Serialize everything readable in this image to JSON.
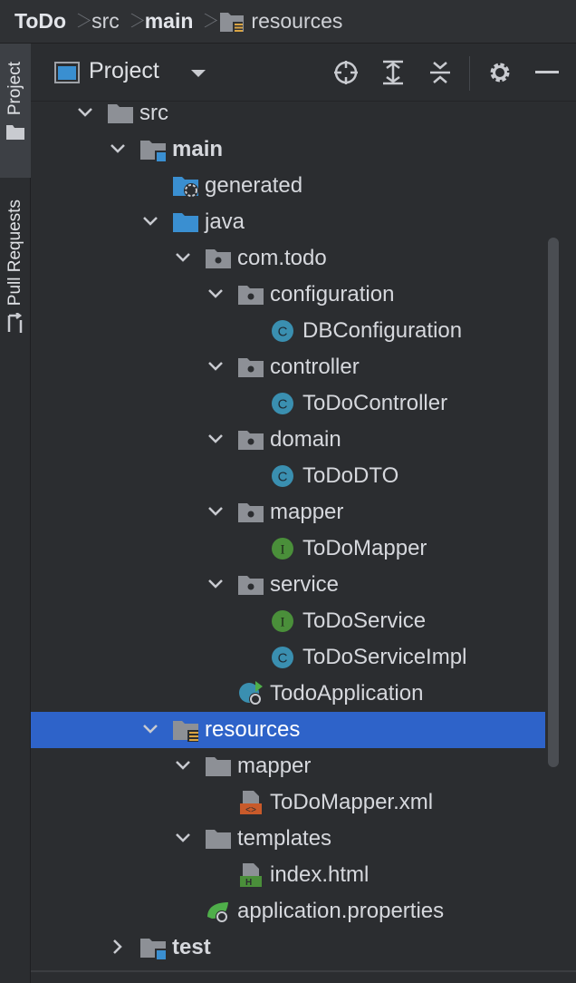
{
  "breadcrumb": {
    "items": [
      "ToDo",
      "src",
      "main",
      "resources"
    ]
  },
  "toolstrip": {
    "project_label": "Project",
    "pull_requests_label": "Pull Requests"
  },
  "panel": {
    "title": "Project"
  },
  "colors": {
    "selection": "#2e63c9",
    "folder_gray": "#8d9096",
    "folder_blue": "#3a8fd1",
    "class_teal": "#3a8fb0",
    "interface_green": "#4a8f3a"
  },
  "tree": [
    {
      "label": "src",
      "icon": "folder-icon",
      "expanded": true,
      "bold": false
    },
    {
      "label": "main",
      "icon": "source-root-folder-icon",
      "expanded": true,
      "bold": true
    },
    {
      "label": "generated",
      "icon": "generated-folder-icon",
      "expanded": null,
      "bold": false
    },
    {
      "label": "java",
      "icon": "blue-folder-icon",
      "expanded": true,
      "bold": false
    },
    {
      "label": "com.todo",
      "icon": "package-icon",
      "expanded": true,
      "bold": false
    },
    {
      "label": "configuration",
      "icon": "package-icon",
      "expanded": true,
      "bold": false
    },
    {
      "label": "DBConfiguration",
      "icon": "class-icon",
      "expanded": null,
      "bold": false
    },
    {
      "label": "controller",
      "icon": "package-icon",
      "expanded": true,
      "bold": false
    },
    {
      "label": "ToDoController",
      "icon": "class-icon",
      "expanded": null,
      "bold": false
    },
    {
      "label": "domain",
      "icon": "package-icon",
      "expanded": true,
      "bold": false
    },
    {
      "label": "ToDoDTO",
      "icon": "class-icon",
      "expanded": null,
      "bold": false
    },
    {
      "label": "mapper",
      "icon": "package-icon",
      "expanded": true,
      "bold": false
    },
    {
      "label": "ToDoMapper",
      "icon": "interface-icon",
      "expanded": null,
      "bold": false
    },
    {
      "label": "service",
      "icon": "package-icon",
      "expanded": true,
      "bold": false
    },
    {
      "label": "ToDoService",
      "icon": "interface-icon",
      "expanded": null,
      "bold": false
    },
    {
      "label": "ToDoServiceImpl",
      "icon": "class-icon",
      "expanded": null,
      "bold": false
    },
    {
      "label": "TodoApplication",
      "icon": "spring-boot-app-icon",
      "expanded": null,
      "bold": false
    },
    {
      "label": "resources",
      "icon": "resources-folder-icon",
      "expanded": true,
      "bold": false,
      "selected": true
    },
    {
      "label": "mapper",
      "icon": "folder-icon",
      "expanded": true,
      "bold": false
    },
    {
      "label": "ToDoMapper.xml",
      "icon": "xml-file-icon",
      "expanded": null,
      "bold": false
    },
    {
      "label": "templates",
      "icon": "folder-icon",
      "expanded": true,
      "bold": false
    },
    {
      "label": "index.html",
      "icon": "html-file-icon",
      "expanded": null,
      "bold": false
    },
    {
      "label": "application.properties",
      "icon": "properties-file-icon",
      "expanded": null,
      "bold": false
    },
    {
      "label": "test",
      "icon": "source-root-folder-icon",
      "expanded": false,
      "bold": true
    }
  ]
}
